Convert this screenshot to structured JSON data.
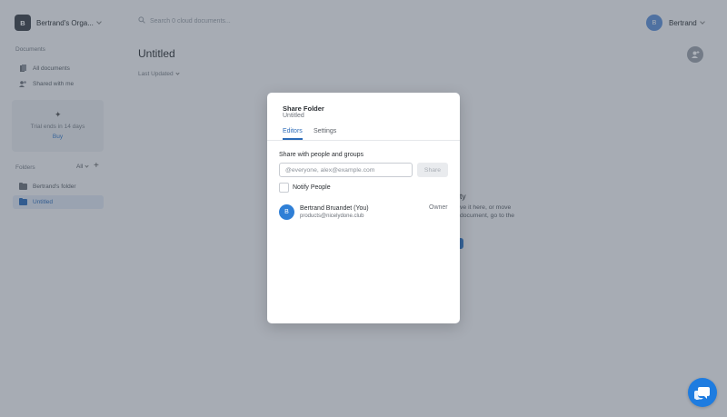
{
  "sidebar": {
    "org_initial": "B",
    "org_name": "Bertrand's Orga...",
    "documents_title": "Documents",
    "nav": [
      {
        "label": "All documents",
        "icon": "documents-icon"
      },
      {
        "label": "Shared with me",
        "icon": "shared-users-icon"
      }
    ],
    "trial": {
      "text": "Trial ends in 14 days",
      "buy": "Buy"
    },
    "folders_title": "Folders",
    "filter": "All",
    "folders": [
      {
        "label": "Bertrand's folder",
        "active": false
      },
      {
        "label": "Untitled",
        "active": true
      }
    ]
  },
  "header": {
    "search_placeholder": "Search 0 cloud documents...",
    "user_initial": "B",
    "user_name": "Bertrand"
  },
  "main": {
    "title": "Untitled",
    "sort_label": "Last Updated",
    "empty_title": "ty",
    "empty_line1": "ve it here, or move",
    "empty_line2": "document, go to the"
  },
  "modal": {
    "title": "Share Folder",
    "subtitle": "Untitled",
    "tabs": [
      "Editors",
      "Settings"
    ],
    "share_label": "Share with people and groups",
    "input_placeholder": "@everyone, alex@example.com",
    "share_button": "Share",
    "notify_label": "Notify People",
    "member": {
      "initial": "B",
      "name": "Bertrand Bruandet (You)",
      "email": "products@nicelydone.club",
      "role": "Owner"
    }
  },
  "colors": {
    "accent": "#2c6bb8",
    "overlay": "rgba(60,72,88,0.42)",
    "chat": "#1e7ce0"
  }
}
